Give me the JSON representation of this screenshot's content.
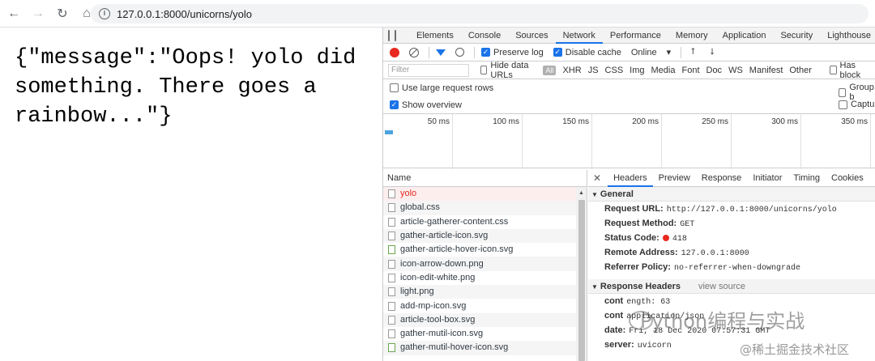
{
  "browser": {
    "url": "127.0.0.1:8000/unicorns/yolo",
    "back_icon": "arrow-left-icon",
    "forward_icon": "arrow-right-icon",
    "reload_icon": "reload-icon",
    "home_icon": "home-icon"
  },
  "page": {
    "json_text": "{\"message\":\"Oops! yolo did something. There goes a rainbow...\"}"
  },
  "devtools": {
    "tabs": [
      "Elements",
      "Console",
      "Sources",
      "Network",
      "Performance",
      "Memory",
      "Application",
      "Security",
      "Lighthouse"
    ],
    "active_tab": "Network",
    "toolbar": {
      "preserve_log": "Preserve log",
      "disable_cache": "Disable cache",
      "throttling": "Online",
      "throttling_arrow": "▾"
    },
    "filter": {
      "placeholder": "Filter",
      "hide_data_urls": "Hide data URLs",
      "all": "All",
      "types": [
        "XHR",
        "JS",
        "CSS",
        "Img",
        "Media",
        "Font",
        "Doc",
        "WS",
        "Manifest",
        "Other"
      ],
      "has_blocked": "Has block"
    },
    "options": {
      "large_rows": "Use large request rows",
      "group": "Group b",
      "show_overview": "Show overview",
      "capture": "Captur"
    },
    "timeline_ticks": [
      "50 ms",
      "100 ms",
      "150 ms",
      "200 ms",
      "250 ms",
      "300 ms",
      "350 ms"
    ],
    "list": {
      "header": "Name",
      "items": [
        {
          "name": "yolo",
          "type": "doc"
        },
        {
          "name": "global.css",
          "type": "doc"
        },
        {
          "name": "article-gatherer-content.css",
          "type": "doc"
        },
        {
          "name": "gather-article-icon.svg",
          "type": "doc"
        },
        {
          "name": "gather-article-hover-icon.svg",
          "type": "img"
        },
        {
          "name": "icon-arrow-down.png",
          "type": "doc"
        },
        {
          "name": "icon-edit-white.png",
          "type": "doc"
        },
        {
          "name": "light.png",
          "type": "doc"
        },
        {
          "name": "add-mp-icon.svg",
          "type": "doc"
        },
        {
          "name": "article-tool-box.svg",
          "type": "doc"
        },
        {
          "name": "gather-mutil-icon.svg",
          "type": "doc"
        },
        {
          "name": "gather-mutil-hover-icon.svg",
          "type": "img"
        }
      ]
    },
    "details": {
      "tabs": [
        "Headers",
        "Preview",
        "Response",
        "Initiator",
        "Timing",
        "Cookies"
      ],
      "active": "Headers",
      "general_title": "General",
      "general": [
        {
          "key": "Request URL:",
          "value": "http://127.0.0.1:8000/unicorns/yolo"
        },
        {
          "key": "Request Method:",
          "value": "GET"
        },
        {
          "key": "Status Code:",
          "value": "418"
        },
        {
          "key": "Remote Address:",
          "value": "127.0.0.1:8000"
        },
        {
          "key": "Referrer Policy:",
          "value": "no-referrer-when-downgrade"
        }
      ],
      "response_title": "Response Headers",
      "view_source": "view source",
      "response": [
        {
          "key": "cont",
          "value": "ength: 63"
        },
        {
          "key": "cont",
          "value": "application/json"
        },
        {
          "key": "date:",
          "value": "Fri, 18 Dec 2020 07:57:31 GMT"
        },
        {
          "key": "server:",
          "value": "uvicorn"
        }
      ]
    }
  },
  "watermarks": {
    "main": "Python编程与实战",
    "site": "@稀土掘金技术社区"
  }
}
